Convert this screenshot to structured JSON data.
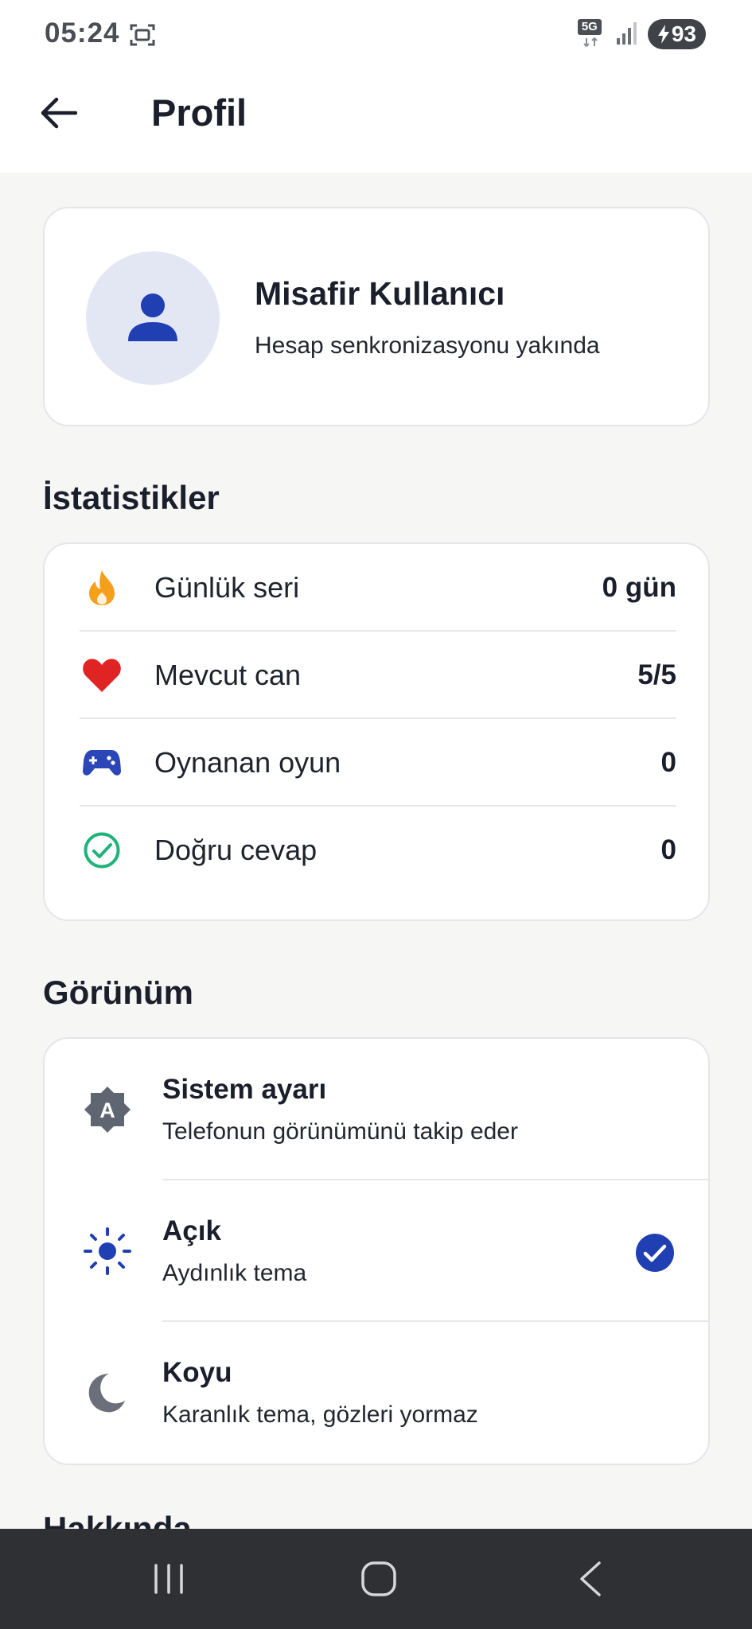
{
  "status_bar": {
    "time": "05:24",
    "network": "5G",
    "battery": "93"
  },
  "app_bar": {
    "title": "Profil"
  },
  "profile": {
    "name": "Misafir Kullanıcı",
    "subtitle": "Hesap senkronizasyonu yakında"
  },
  "stats": {
    "title": "İstatistikler",
    "items": [
      {
        "icon": "flame-icon",
        "label": "Günlük seri",
        "value": "0 gün",
        "color": "#f5a01a"
      },
      {
        "icon": "heart-icon",
        "label": "Mevcut can",
        "value": "5/5",
        "color": "#e02424"
      },
      {
        "icon": "gamepad-icon",
        "label": "Oynanan oyun",
        "value": "0",
        "color": "#2a46b8"
      },
      {
        "icon": "check-circle-icon",
        "label": "Doğru cevap",
        "value": "0",
        "color": "#1fb27a"
      }
    ]
  },
  "appearance": {
    "title": "Görünüm",
    "options": [
      {
        "icon": "auto-brightness-icon",
        "title": "Sistem ayarı",
        "subtitle": "Telefonun görünümünü takip eder",
        "selected": false
      },
      {
        "icon": "sun-icon",
        "title": "Açık",
        "subtitle": "Aydınlık tema",
        "selected": true
      },
      {
        "icon": "moon-icon",
        "title": "Koyu",
        "subtitle": "Karanlık tema, gözleri yormaz",
        "selected": false
      }
    ]
  },
  "next_section": {
    "title": "Hakkında"
  },
  "colors": {
    "accent": "#2a46b8",
    "background": "#f6f6f4",
    "navbar": "#2f3033"
  }
}
